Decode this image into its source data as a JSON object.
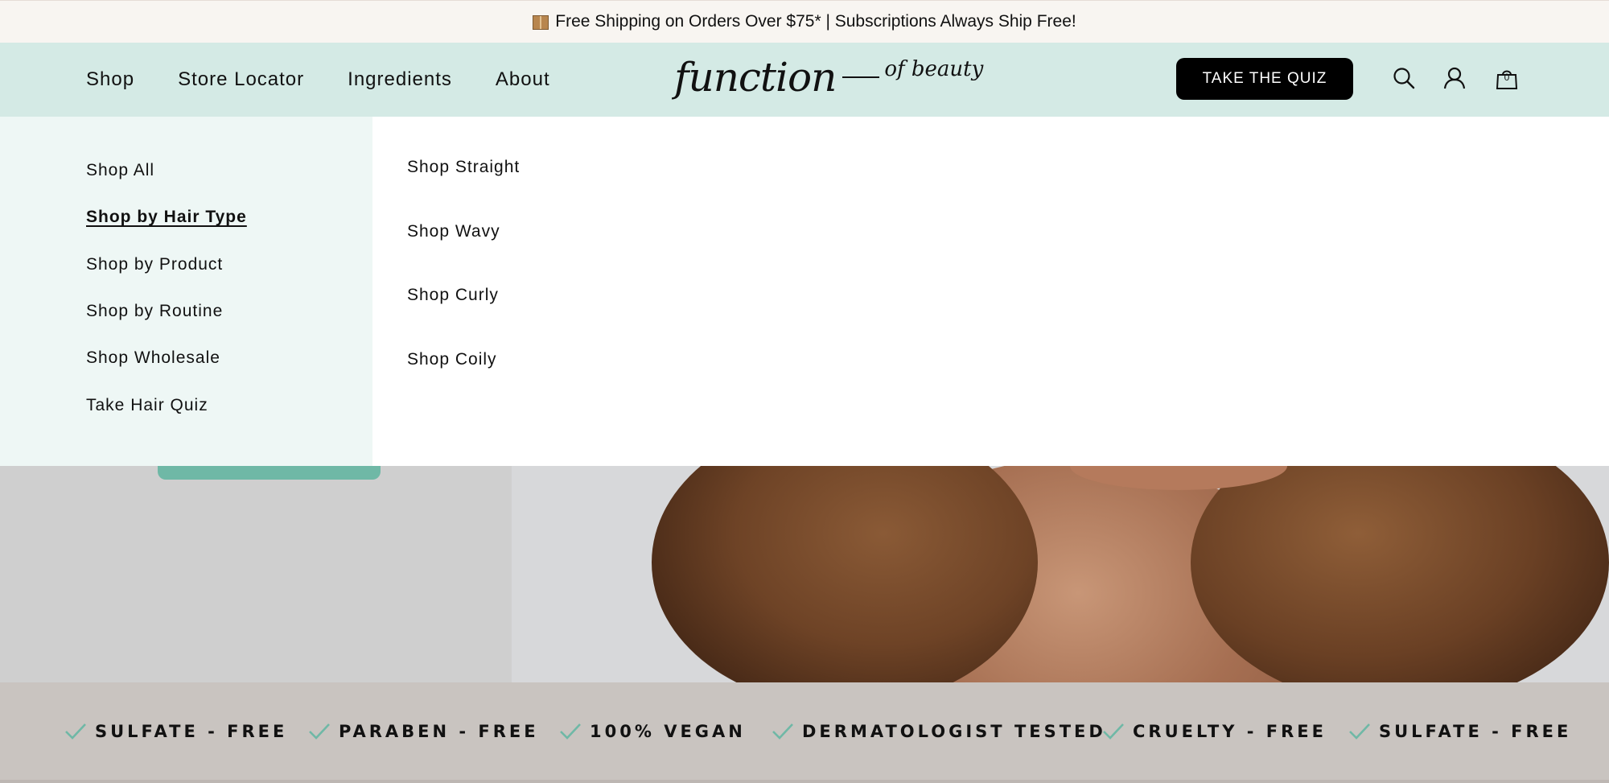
{
  "announcement": {
    "text": "Free Shipping on Orders Over $75* | Subscriptions Always Ship Free!",
    "icon": "package-icon"
  },
  "nav": {
    "items": [
      "Shop",
      "Store Locator",
      "Ingredients",
      "About"
    ]
  },
  "logo": {
    "primary": "function",
    "secondary": "of beauty"
  },
  "header": {
    "quiz_button": "TAKE THE QUIZ",
    "cart_count": "0"
  },
  "mega_menu": {
    "categories": [
      "Shop All",
      "Shop by Hair Type",
      "Shop by Product",
      "Shop by Routine",
      "Shop Wholesale",
      "Take Hair Quiz"
    ],
    "active_category": "Shop by Hair Type",
    "subitems": [
      "Shop Straight",
      "Shop Wavy",
      "Shop Curly",
      "Shop Coily"
    ]
  },
  "claims": [
    "SULFATE - FREE",
    "PARABEN - FREE",
    "100% VEGAN",
    "DERMATOLOGIST TESTED",
    "CRUELTY - FREE",
    "SULFATE - FREE"
  ],
  "colors": {
    "header_bg": "#d4eae5",
    "menu_left_bg": "#eef7f5",
    "accent_teal": "#6fb8a6",
    "claims_bg": "#c9c4c0",
    "button_bg": "#000000"
  }
}
